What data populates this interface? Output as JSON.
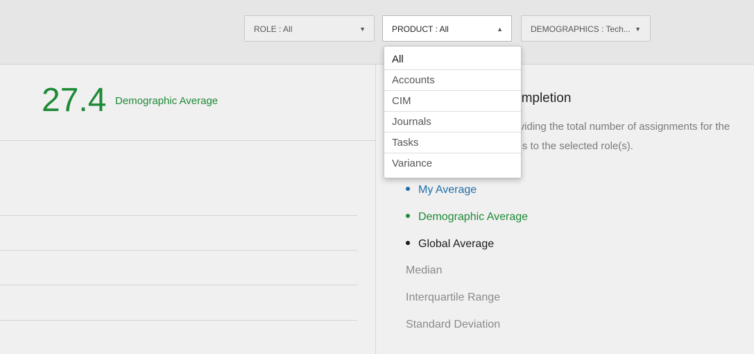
{
  "filters": {
    "role": {
      "label": "ROLE : All"
    },
    "product": {
      "label": "PRODUCT : All",
      "expanded": true
    },
    "demographics": {
      "label": "DEMOGRAPHICS : Tech..."
    }
  },
  "product_options": [
    "All",
    "Accounts",
    "CIM",
    "Journals",
    "Tasks",
    "Variance"
  ],
  "metric": {
    "value": "27.4",
    "label": "Demographic Average"
  },
  "section": {
    "title": "ompletion",
    "desc_line1": "dividing the total number of assignments for the",
    "desc_line2": "ess to the selected role(s)."
  },
  "legend": {
    "my_average": "My Average",
    "demographic_average": "Demographic Average",
    "global_average": "Global Average",
    "median": "Median",
    "iqr": "Interquartile Range",
    "std_dev": "Standard Deviation"
  },
  "icons": {
    "caret_down": "▼",
    "caret_up": "▲"
  },
  "colors": {
    "green": "#1e8a36",
    "blue": "#1f6ea8",
    "black": "#1a1a1a",
    "gray": "#8a8a8a"
  }
}
